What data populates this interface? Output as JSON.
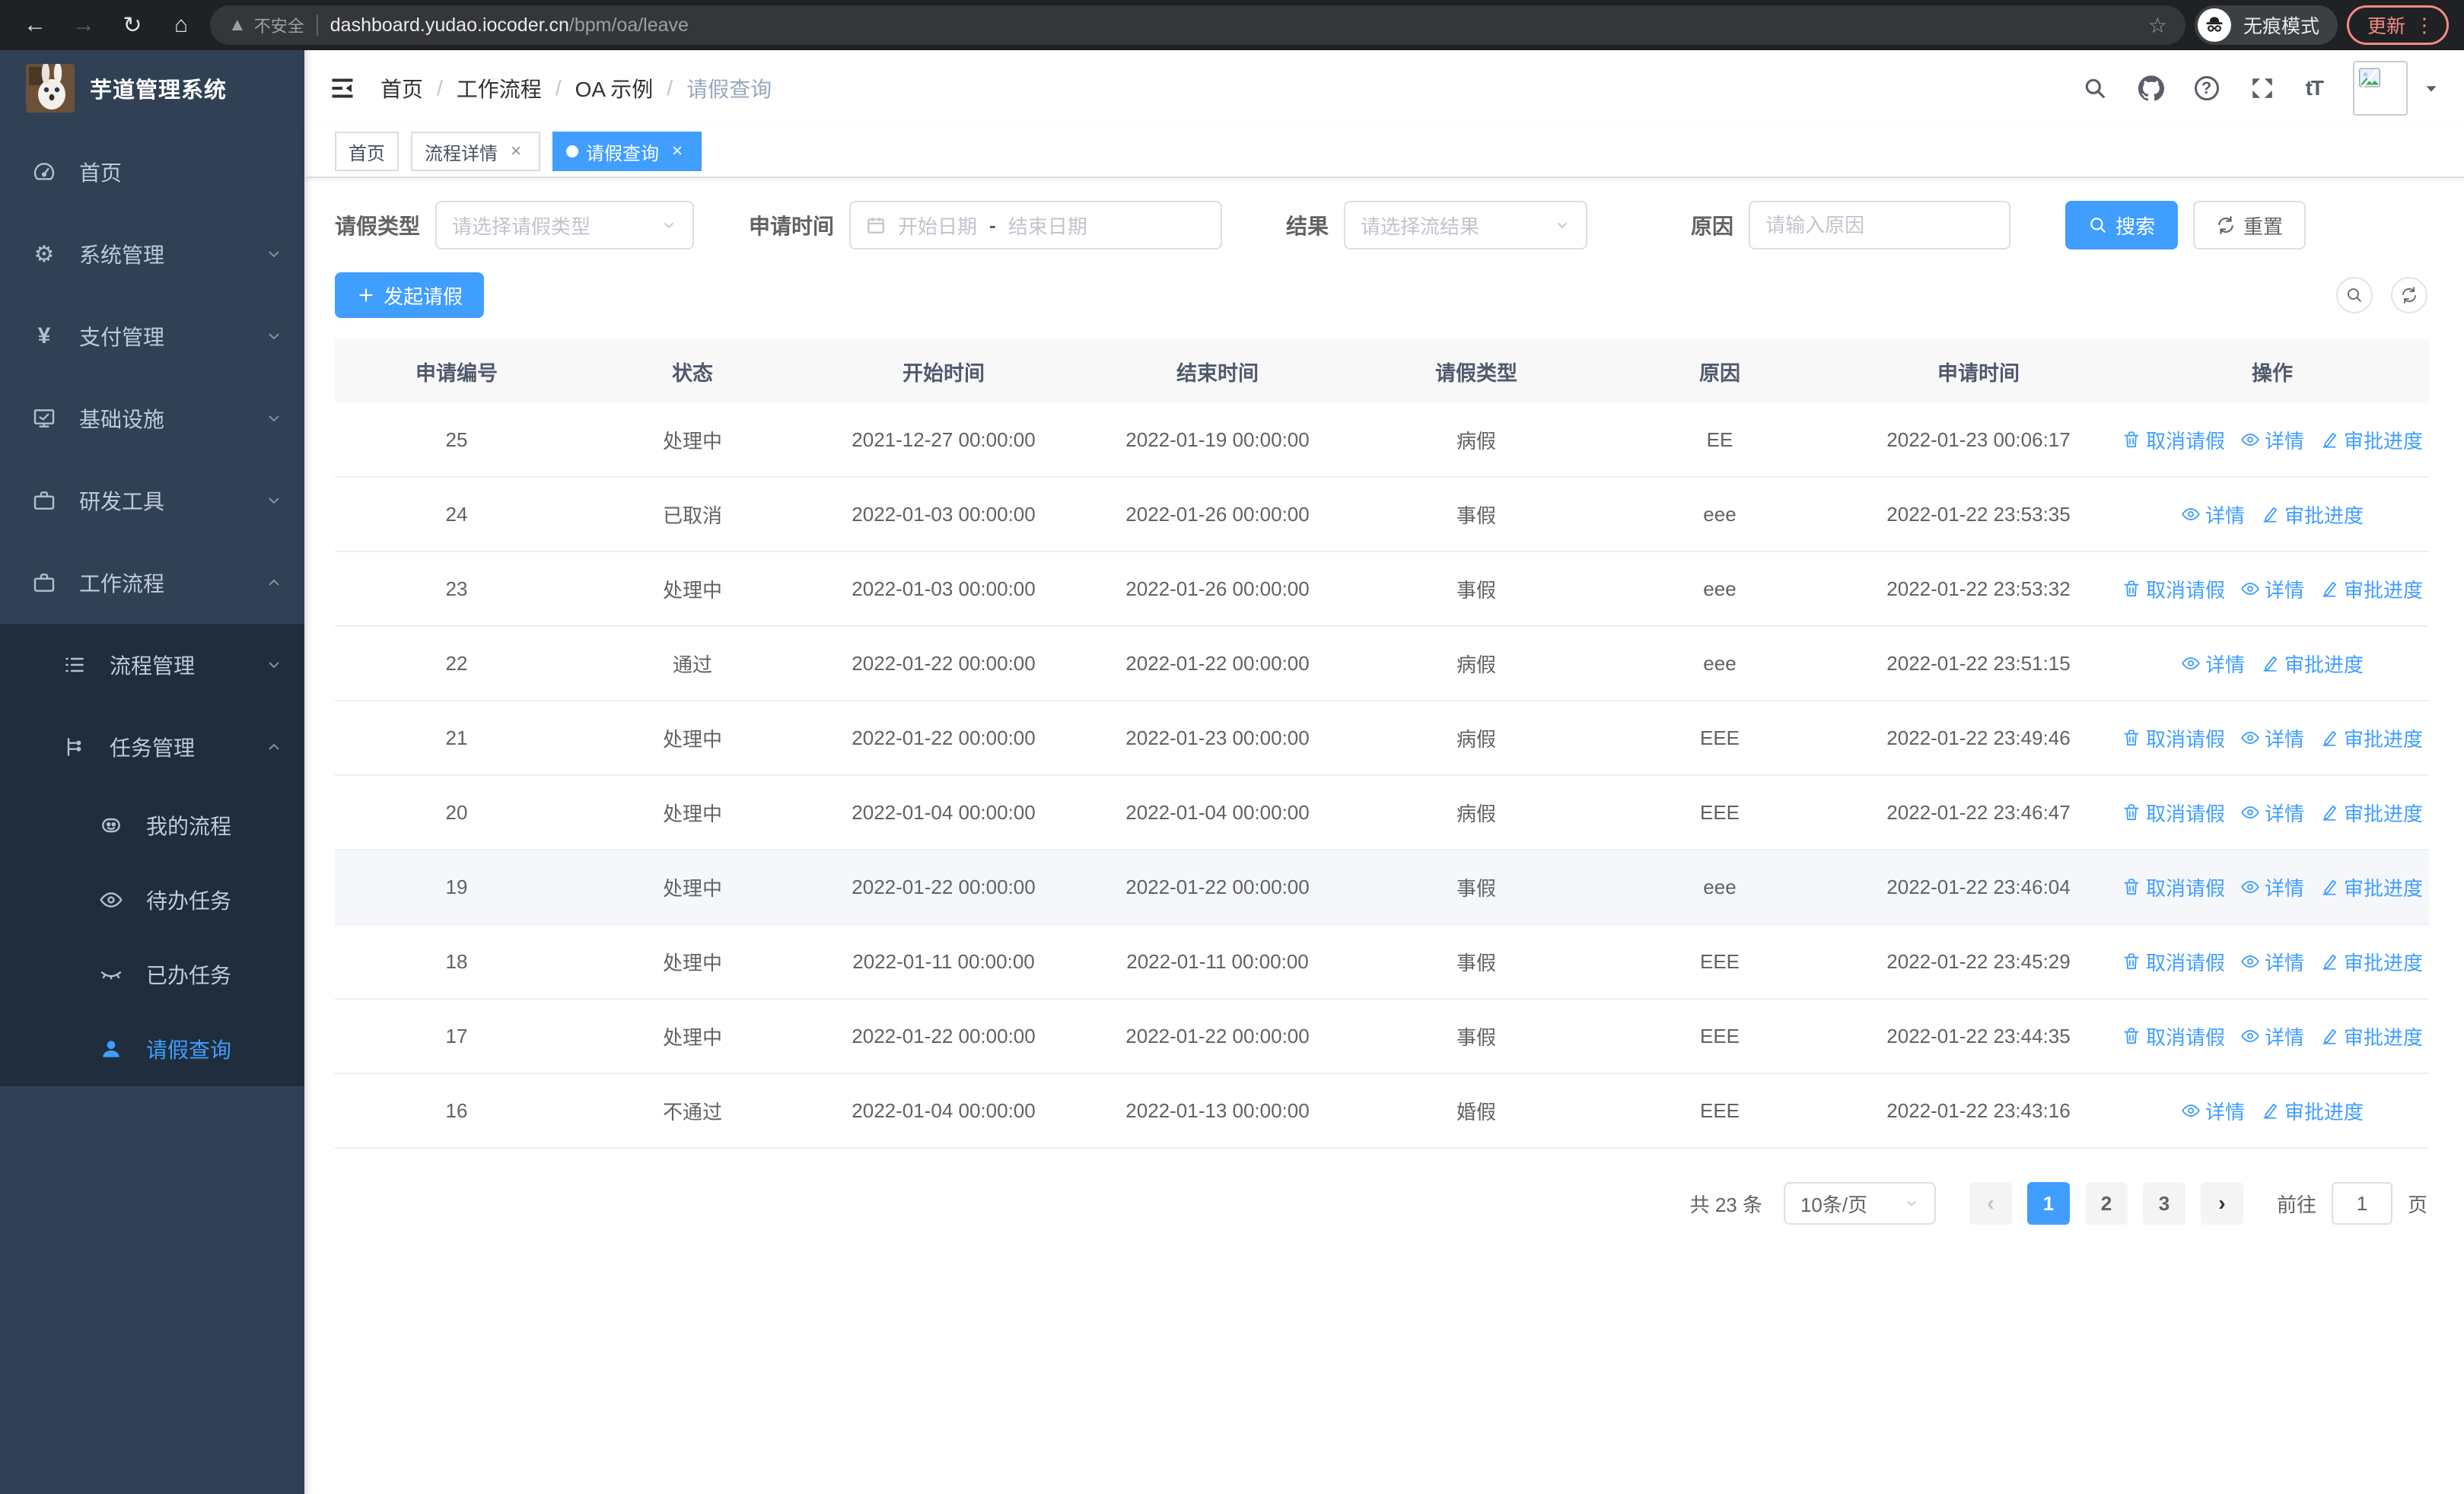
{
  "browser": {
    "security_label": "不安全",
    "url_host": "dashboard.yudao.iocoder.cn",
    "url_path": "/bpm/oa/leave",
    "incognito_label": "无痕模式",
    "update_label": "更新"
  },
  "sidebar": {
    "title": "芋道管理系统",
    "items": [
      {
        "label": "首页"
      },
      {
        "label": "系统管理",
        "expandable": true
      },
      {
        "label": "支付管理",
        "expandable": true
      },
      {
        "label": "基础设施",
        "expandable": true
      },
      {
        "label": "研发工具",
        "expandable": true
      },
      {
        "label": "工作流程",
        "expanded": true,
        "children": [
          {
            "label": "流程管理",
            "expandable": true
          },
          {
            "label": "任务管理",
            "expanded": true,
            "children": [
              {
                "label": "我的流程"
              },
              {
                "label": "待办任务"
              },
              {
                "label": "已办任务"
              },
              {
                "label": "请假查询",
                "active": true
              }
            ]
          }
        ]
      }
    ]
  },
  "header": {
    "breadcrumb": [
      "首页",
      "工作流程",
      "OA 示例",
      "请假查询"
    ]
  },
  "tabs": [
    {
      "label": "首页",
      "closable": false,
      "active": false
    },
    {
      "label": "流程详情",
      "closable": true,
      "active": false
    },
    {
      "label": "请假查询",
      "closable": true,
      "active": true
    }
  ],
  "filters": {
    "leave_type": {
      "label": "请假类型",
      "placeholder": "请选择请假类型"
    },
    "apply_time": {
      "label": "申请时间",
      "start_placeholder": "开始日期",
      "separator": "-",
      "end_placeholder": "结束日期"
    },
    "result": {
      "label": "结果",
      "placeholder": "请选择流结果"
    },
    "reason": {
      "label": "原因",
      "placeholder": "请输入原因"
    },
    "search_label": "搜索",
    "reset_label": "重置"
  },
  "toolbar": {
    "create_label": "发起请假"
  },
  "table": {
    "columns": [
      "申请编号",
      "状态",
      "开始时间",
      "结束时间",
      "请假类型",
      "原因",
      "申请时间",
      "操作"
    ],
    "action_labels": {
      "cancel": "取消请假",
      "detail": "详情",
      "progress": "审批进度"
    },
    "rows": [
      {
        "id": "25",
        "status": "处理中",
        "start": "2021-12-27 00:00:00",
        "end": "2022-01-19 00:00:00",
        "type": "病假",
        "reason": "EE",
        "applied": "2022-01-23 00:06:17",
        "cancelable": true,
        "highlight": false
      },
      {
        "id": "24",
        "status": "已取消",
        "start": "2022-01-03 00:00:00",
        "end": "2022-01-26 00:00:00",
        "type": "事假",
        "reason": "eee",
        "applied": "2022-01-22 23:53:35",
        "cancelable": false,
        "highlight": false
      },
      {
        "id": "23",
        "status": "处理中",
        "start": "2022-01-03 00:00:00",
        "end": "2022-01-26 00:00:00",
        "type": "事假",
        "reason": "eee",
        "applied": "2022-01-22 23:53:32",
        "cancelable": true,
        "highlight": false
      },
      {
        "id": "22",
        "status": "通过",
        "start": "2022-01-22 00:00:00",
        "end": "2022-01-22 00:00:00",
        "type": "病假",
        "reason": "eee",
        "applied": "2022-01-22 23:51:15",
        "cancelable": false,
        "highlight": false
      },
      {
        "id": "21",
        "status": "处理中",
        "start": "2022-01-22 00:00:00",
        "end": "2022-01-23 00:00:00",
        "type": "病假",
        "reason": "EEE",
        "applied": "2022-01-22 23:49:46",
        "cancelable": true,
        "highlight": false
      },
      {
        "id": "20",
        "status": "处理中",
        "start": "2022-01-04 00:00:00",
        "end": "2022-01-04 00:00:00",
        "type": "病假",
        "reason": "EEE",
        "applied": "2022-01-22 23:46:47",
        "cancelable": true,
        "highlight": false
      },
      {
        "id": "19",
        "status": "处理中",
        "start": "2022-01-22 00:00:00",
        "end": "2022-01-22 00:00:00",
        "type": "事假",
        "reason": "eee",
        "applied": "2022-01-22 23:46:04",
        "cancelable": true,
        "highlight": true
      },
      {
        "id": "18",
        "status": "处理中",
        "start": "2022-01-11 00:00:00",
        "end": "2022-01-11 00:00:00",
        "type": "事假",
        "reason": "EEE",
        "applied": "2022-01-22 23:45:29",
        "cancelable": true,
        "highlight": false
      },
      {
        "id": "17",
        "status": "处理中",
        "start": "2022-01-22 00:00:00",
        "end": "2022-01-22 00:00:00",
        "type": "事假",
        "reason": "EEE",
        "applied": "2022-01-22 23:44:35",
        "cancelable": true,
        "highlight": false
      },
      {
        "id": "16",
        "status": "不通过",
        "start": "2022-01-04 00:00:00",
        "end": "2022-01-13 00:00:00",
        "type": "婚假",
        "reason": "EEE",
        "applied": "2022-01-22 23:43:16",
        "cancelable": false,
        "highlight": false
      }
    ]
  },
  "pagination": {
    "total_text": "共 23 条",
    "page_size": "10条/页",
    "pages": [
      "1",
      "2",
      "3"
    ],
    "active_page": "1",
    "goto_label": "前往",
    "goto_value": "1",
    "unit_label": "页"
  },
  "colors": {
    "accent": "#409eff",
    "sidebar_bg": "#304156",
    "submenu_bg": "#1f2d3d",
    "sidebar_text": "#bfcbd9",
    "chrome_bg": "#202124",
    "update_accent": "#f28b82"
  }
}
